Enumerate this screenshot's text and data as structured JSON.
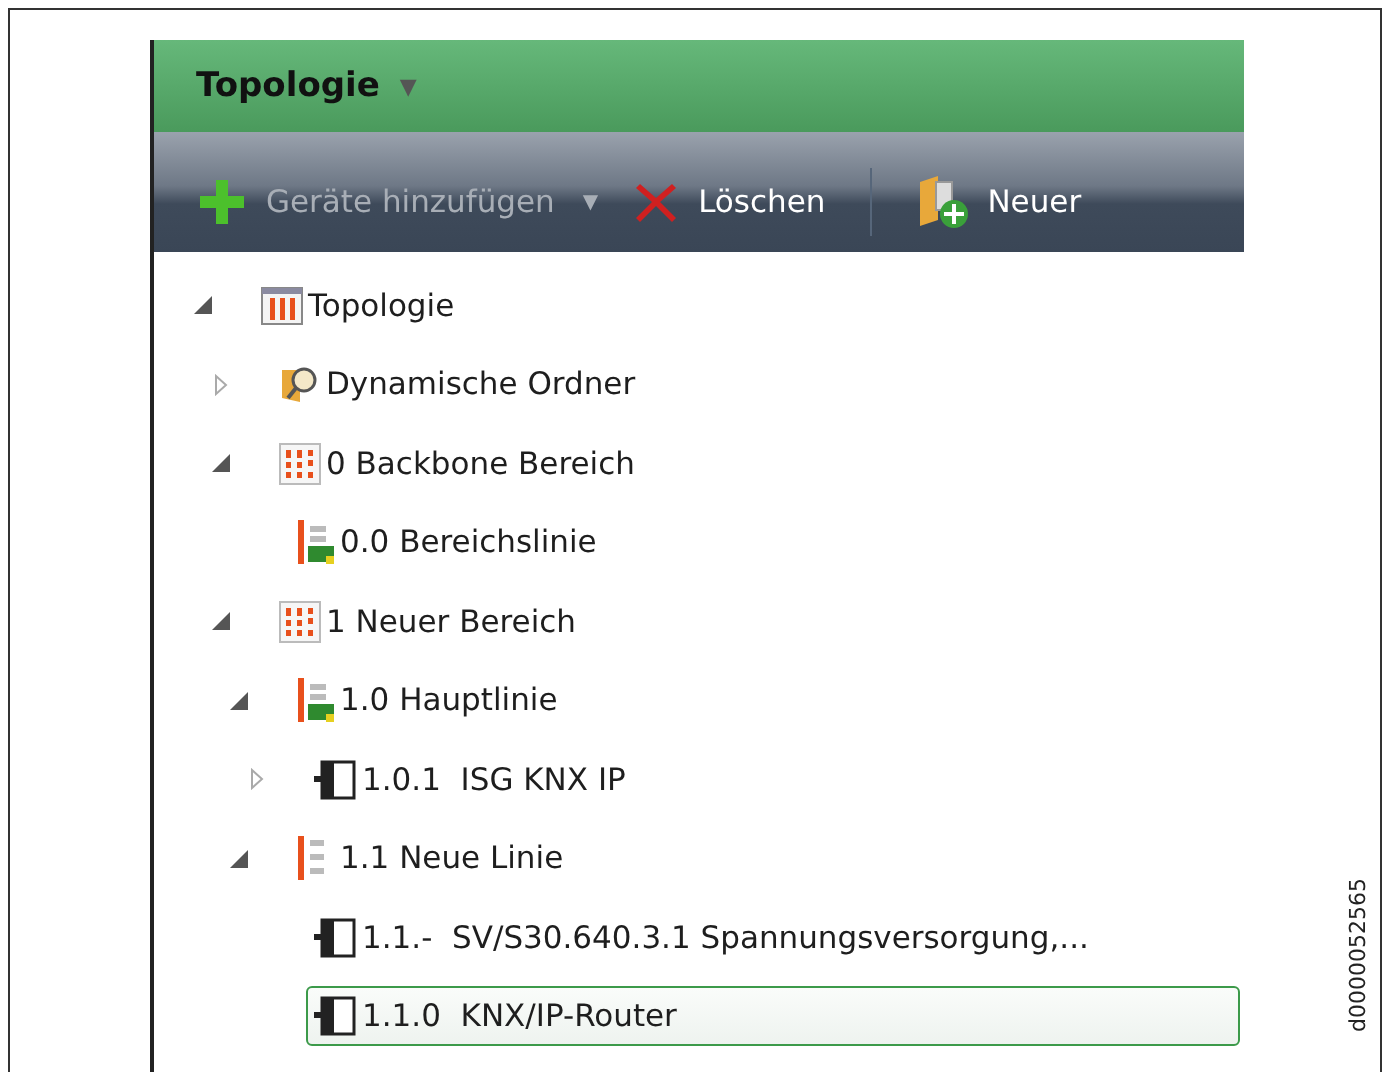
{
  "panel": {
    "title": "Topologie",
    "title_menu": "▼"
  },
  "toolbar": [
    {
      "kind": "add",
      "label": "Geräte hinzufügen",
      "disabled": true,
      "dropdown": "▼"
    },
    {
      "kind": "delete",
      "label": "Löschen",
      "disabled": false
    },
    {
      "kind": "new",
      "label": "Neuer",
      "disabled": false
    }
  ],
  "tree": [
    {
      "label": "Topologie",
      "kind": "topology",
      "expanded": true,
      "selected": false,
      "children": [
        {
          "label": "Dynamische Ordner",
          "kind": "folder",
          "expanded": false,
          "selected": false
        },
        {
          "label": "0 Backbone Bereich",
          "kind": "area",
          "expanded": true,
          "selected": false,
          "children": [
            {
              "label": "0.0 Bereichslinie",
              "kind": "line",
              "selected": false
            }
          ]
        },
        {
          "label": "1 Neuer Bereich",
          "kind": "area",
          "expanded": true,
          "selected": false,
          "children": [
            {
              "label": "1.0 Hauptlinie",
              "kind": "line",
              "expanded": true,
              "selected": false,
              "children": [
                {
                  "label": "1.0.1  ISG KNX IP",
                  "kind": "device",
                  "expanded": false,
                  "selected": false
                }
              ]
            },
            {
              "label": "1.1 Neue Linie",
              "kind": "line-empty",
              "expanded": true,
              "selected": false,
              "children": [
                {
                  "label": "1.1.-  SV/S30.640.3.1 Spannungsversorgung,...",
                  "kind": "device",
                  "selected": false
                },
                {
                  "label": "1.1.0  KNX/IP-Router",
                  "kind": "device",
                  "selected": true
                }
              ]
            }
          ]
        }
      ]
    }
  ],
  "document_id": "d0000052565"
}
